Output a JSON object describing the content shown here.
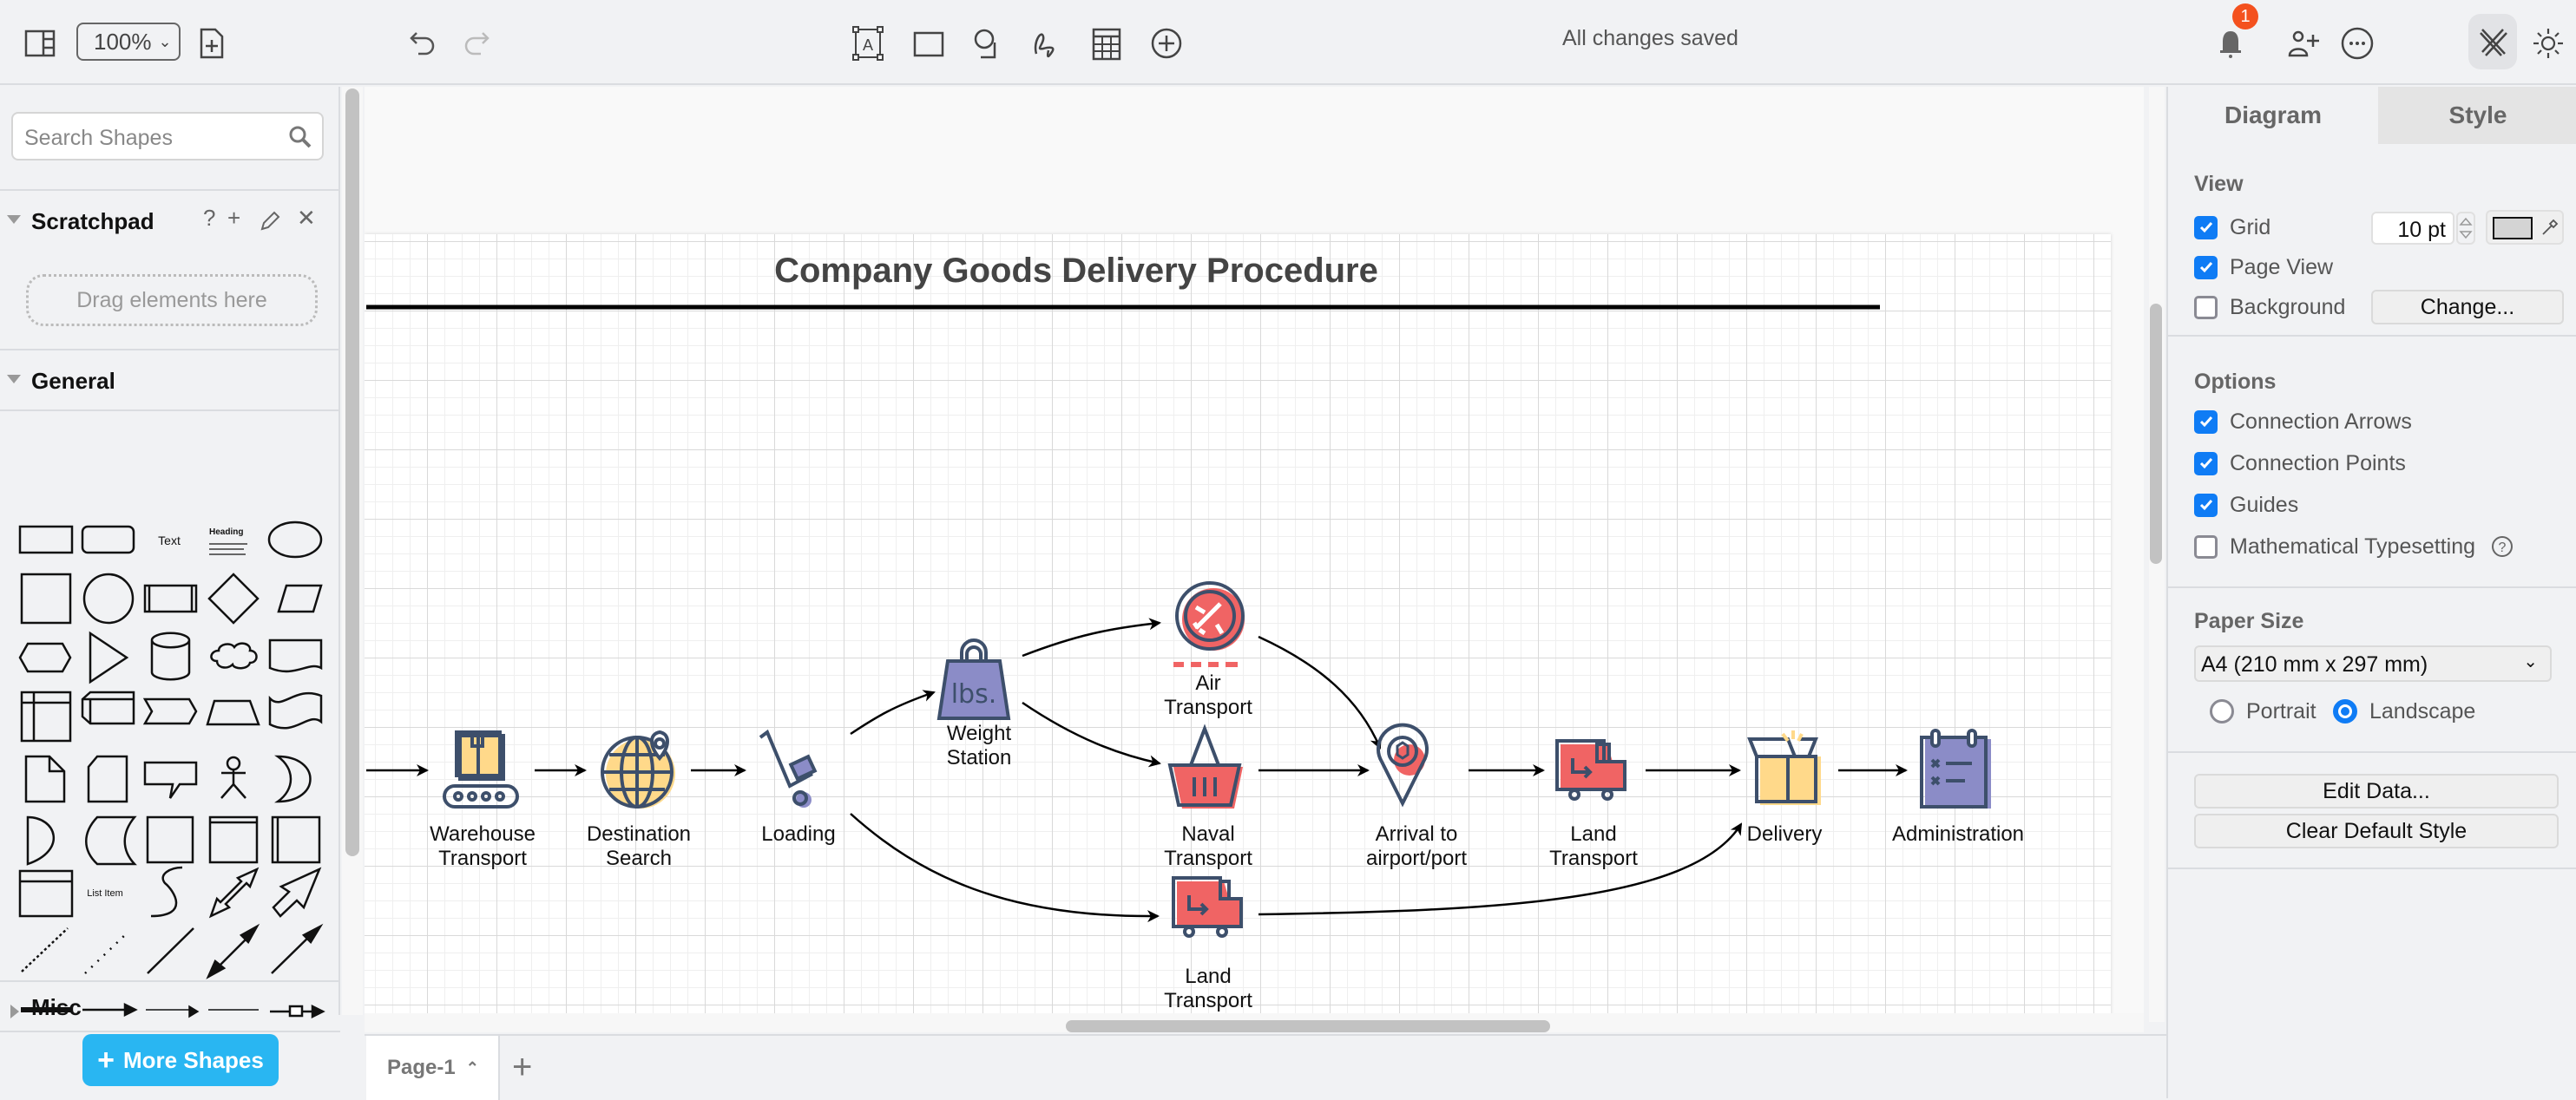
{
  "toolbar": {
    "zoom_level": "100%",
    "save_status": "All changes saved",
    "notification_count": "1",
    "icons": [
      "sidebar-toggle-icon",
      "new-page-icon",
      "undo-icon",
      "redo-icon",
      "text-icon",
      "rectangle-icon",
      "shapes-icon",
      "freehand-icon",
      "table-icon",
      "insert-icon",
      "bell-icon",
      "share-icon",
      "more-icon",
      "format-panel-icon",
      "theme-icon"
    ]
  },
  "sidebar": {
    "search_placeholder": "Search Shapes",
    "scratchpad": {
      "title": "Scratchpad",
      "help": "?",
      "drop_hint": "Drag elements here"
    },
    "general": {
      "title": "General",
      "text_shape_label": "Text",
      "heading_shape_label": "Heading",
      "list_item_label": "List Item"
    },
    "misc": {
      "title": "Misc"
    },
    "more_shapes_label": "More Shapes"
  },
  "diagram": {
    "title": "Company Goods Delivery Procedure",
    "nodes": [
      {
        "id": "warehouse",
        "label_line1": "Warehouse",
        "label_line2": "Transport",
        "icon": "conveyor-box-icon"
      },
      {
        "id": "destination",
        "label_line1": "Destination",
        "label_line2": "Search",
        "icon": "globe-pin-icon"
      },
      {
        "id": "loading",
        "label_line1": "Loading",
        "label_line2": "",
        "icon": "hand-truck-icon"
      },
      {
        "id": "weight",
        "label_line1": "Weight",
        "label_line2": "Station",
        "icon": "weight-icon",
        "icon_text": "lbs."
      },
      {
        "id": "air",
        "label_line1": "Air",
        "label_line2": "Transport",
        "icon": "airplane-icon"
      },
      {
        "id": "naval",
        "label_line1": "Naval",
        "label_line2": "Transport",
        "icon": "basket-icon"
      },
      {
        "id": "land_lower",
        "label_line1": "Land",
        "label_line2": "Transport",
        "icon": "truck-icon"
      },
      {
        "id": "arrival",
        "label_line1": "Arrival to",
        "label_line2": "airport/port",
        "icon": "location-pin-icon"
      },
      {
        "id": "land",
        "label_line1": "Land",
        "label_line2": "Transport",
        "icon": "truck-icon"
      },
      {
        "id": "delivery",
        "label_line1": "Delivery",
        "label_line2": "",
        "icon": "open-box-icon"
      },
      {
        "id": "administration",
        "label_line1": "Administration",
        "label_line2": "",
        "icon": "checklist-icon"
      }
    ],
    "edges": [
      [
        "start",
        "warehouse"
      ],
      [
        "warehouse",
        "destination"
      ],
      [
        "destination",
        "loading"
      ],
      [
        "loading",
        "weight"
      ],
      [
        "loading",
        "land_lower"
      ],
      [
        "weight",
        "air"
      ],
      [
        "weight",
        "naval"
      ],
      [
        "air",
        "arrival"
      ],
      [
        "naval",
        "arrival"
      ],
      [
        "arrival",
        "land"
      ],
      [
        "land",
        "delivery"
      ],
      [
        "land_lower",
        "delivery"
      ],
      [
        "delivery",
        "administration"
      ]
    ],
    "colors": {
      "stroke": "#3d4f6b",
      "yellow": "#ffd98a",
      "red": "#f06464",
      "purple": "#8b8cc7"
    }
  },
  "page_tabs": {
    "current": "Page-1",
    "add_label": "+"
  },
  "format_panel": {
    "tabs": [
      "Diagram",
      "Style"
    ],
    "active_tab": "Diagram",
    "view": {
      "title": "View",
      "grid": {
        "label": "Grid",
        "checked": true,
        "size": "10 pt"
      },
      "page_view": {
        "label": "Page View",
        "checked": true
      },
      "background": {
        "label": "Background",
        "checked": false,
        "button": "Change..."
      }
    },
    "options": {
      "title": "Options",
      "connection_arrows": {
        "label": "Connection Arrows",
        "checked": true
      },
      "connection_points": {
        "label": "Connection Points",
        "checked": true
      },
      "guides": {
        "label": "Guides",
        "checked": true
      },
      "math": {
        "label": "Mathematical Typesetting",
        "checked": false
      }
    },
    "paper": {
      "title": "Paper Size",
      "selected": "A4 (210 mm x 297 mm)",
      "portrait": "Portrait",
      "landscape": "Landscape",
      "orientation": "Landscape"
    },
    "edit_data_label": "Edit Data...",
    "clear_style_label": "Clear Default Style"
  }
}
